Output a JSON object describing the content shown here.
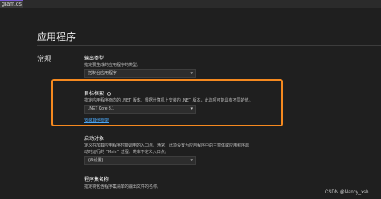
{
  "tab": {
    "label": "gram.cs"
  },
  "page": {
    "title": "应用程序",
    "section": "常规"
  },
  "output_type": {
    "heading": "输出类型",
    "description": "指定要生成的应用程序的类型。",
    "value": "控制台应用程序"
  },
  "target_framework": {
    "heading": "目标框架",
    "description": "指定应用程序面向的 .NET 版本。根据计算机上安装的 .NET 版本，此选项可能具有不同的值。",
    "value": ".NET Core 3.1",
    "link": "安装其他框架"
  },
  "startup_object": {
    "heading": "启动对象",
    "description_line1": "定义在加载应用程序时要调用的入口点。通常，此项设置为应用程序中的主窗体或应用程序启",
    "description_line2": "动时运行的 \"Main\" 过程。类库不定义入口点。",
    "value": "(未设置)"
  },
  "assembly_name": {
    "heading": "程序集名称",
    "description": "指定将包含程序集清单的输出文件的名称。"
  },
  "watermark": "CSDN @Nancy_xsh",
  "colors": {
    "highlight": "#f5891f",
    "link": "#4aa3f0",
    "background": "#1f1f1f"
  }
}
